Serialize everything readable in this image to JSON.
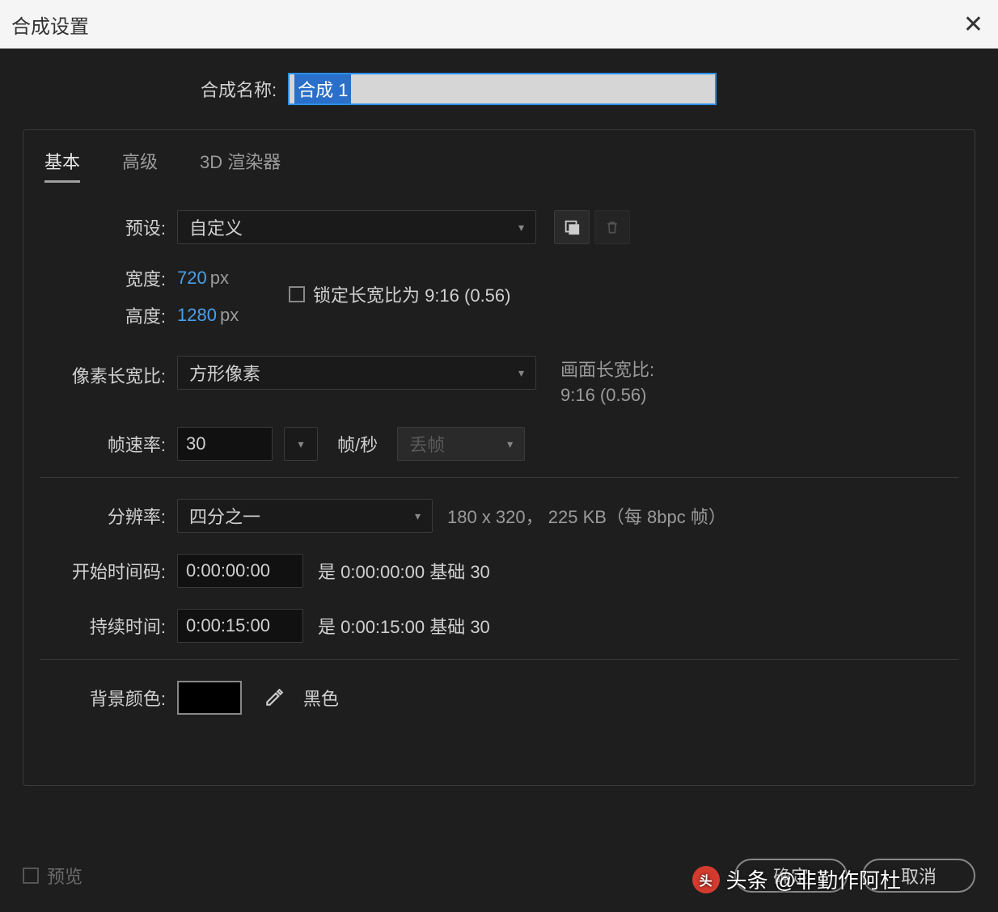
{
  "title": "合成设置",
  "comp_name_label": "合成名称:",
  "comp_name_value": "合成 1",
  "tabs": {
    "basic": "基本",
    "advanced": "高级",
    "renderer": "3D 渲染器"
  },
  "preset": {
    "label": "预设:",
    "value": "自定义"
  },
  "width": {
    "label": "宽度:",
    "value": "720",
    "unit": "px"
  },
  "height": {
    "label": "高度:",
    "value": "1280",
    "unit": "px"
  },
  "lock_aspect": "锁定长宽比为 9:16 (0.56)",
  "pixel_aspect": {
    "label": "像素长宽比:",
    "value": "方形像素"
  },
  "frame_aspect": {
    "label": "画面长宽比:",
    "value": "9:16 (0.56)"
  },
  "frame_rate": {
    "label": "帧速率:",
    "value": "30",
    "unit": "帧/秒",
    "drop": "丢帧"
  },
  "resolution": {
    "label": "分辨率:",
    "value": "四分之一",
    "info": "180 x 320，   225 KB（每 8bpc 帧）"
  },
  "start_tc": {
    "label": "开始时间码:",
    "value": "0:00:00:00",
    "info": "是 0:00:00:00  基础 30"
  },
  "duration": {
    "label": "持续时间:",
    "value": "0:00:15:00",
    "info": "是 0:00:15:00  基础 30"
  },
  "bg_color": {
    "label": "背景颜色:",
    "name": "黑色"
  },
  "preview": "预览",
  "ok": "确定",
  "cancel": "取消",
  "watermark": "@非勤作阿杜",
  "watermark_prefix": "头条"
}
